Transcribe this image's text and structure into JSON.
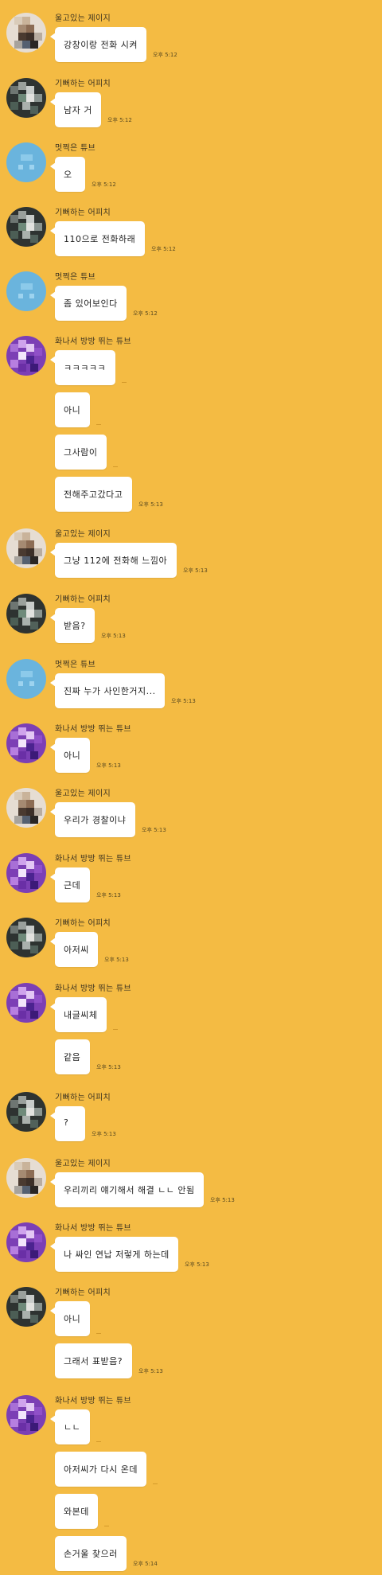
{
  "chat": {
    "groups": [
      {
        "sender": "울고있는 제이지",
        "avatar": "avatar-jayg-icon",
        "messages": [
          {
            "text": "강창이랑 전화 시켜",
            "time": "오후 5:12"
          }
        ]
      },
      {
        "sender": "기뻐하는 어피치",
        "avatar": "avatar-apeach-icon",
        "messages": [
          {
            "text": "남자 거",
            "time": "오후 5:12"
          }
        ]
      },
      {
        "sender": "멋쩍은 튜브",
        "avatar": "avatar-tube-blue-icon",
        "messages": [
          {
            "text": "오",
            "time": "오후 5:12"
          }
        ]
      },
      {
        "sender": "기뻐하는 어피치",
        "avatar": "avatar-apeach-icon",
        "messages": [
          {
            "text": "110으로 전화하래",
            "time": "오후 5:12"
          }
        ]
      },
      {
        "sender": "멋쩍은 튜브",
        "avatar": "avatar-tube-blue-icon",
        "messages": [
          {
            "text": "좀 있어보인다",
            "time": "오후 5:12"
          }
        ]
      },
      {
        "sender": "화나서 방방 뛰는 튜브",
        "avatar": "avatar-tube-purple-icon",
        "messages": [
          {
            "text": "ㅋㅋㅋㅋㅋ",
            "time": ""
          },
          {
            "text": "아니",
            "time": ""
          },
          {
            "text": "그사람이",
            "time": ""
          },
          {
            "text": "전해주고갔다고",
            "time": "오후 5:13"
          }
        ]
      },
      {
        "sender": "울고있는 제이지",
        "avatar": "avatar-jayg-icon",
        "messages": [
          {
            "text": "그냥 112에 전화해 느낌아",
            "time": "오후 5:13"
          }
        ]
      },
      {
        "sender": "기뻐하는 어피치",
        "avatar": "avatar-apeach-icon",
        "messages": [
          {
            "text": "받음?",
            "time": "오후 5:13"
          }
        ]
      },
      {
        "sender": "멋쩍은 튜브",
        "avatar": "avatar-tube-blue-icon",
        "messages": [
          {
            "text": "진짜 누가 사인한거지...",
            "time": "오후 5:13"
          }
        ]
      },
      {
        "sender": "화나서 방방 뛰는 튜브",
        "avatar": "avatar-tube-purple-icon",
        "messages": [
          {
            "text": "아니",
            "time": "오후 5:13"
          }
        ]
      },
      {
        "sender": "울고있는 제이지",
        "avatar": "avatar-jayg-icon",
        "messages": [
          {
            "text": "우리가 경찰이냐",
            "time": "오후 5:13"
          }
        ]
      },
      {
        "sender": "화나서 방방 뛰는 튜브",
        "avatar": "avatar-tube-purple-icon",
        "messages": [
          {
            "text": "근데",
            "time": "오후 5:13"
          }
        ]
      },
      {
        "sender": "기뻐하는 어피치",
        "avatar": "avatar-apeach-icon",
        "messages": [
          {
            "text": "아저씨",
            "time": "오후 5:13"
          }
        ]
      },
      {
        "sender": "화나서 방방 뛰는 튜브",
        "avatar": "avatar-tube-purple-icon",
        "messages": [
          {
            "text": "내글씨체",
            "time": ""
          },
          {
            "text": "같음",
            "time": "오후 5:13"
          }
        ]
      },
      {
        "sender": "기뻐하는 어피치",
        "avatar": "avatar-apeach-icon",
        "messages": [
          {
            "text": "?",
            "time": "오후 5:13"
          }
        ]
      },
      {
        "sender": "울고있는 제이지",
        "avatar": "avatar-jayg-icon",
        "messages": [
          {
            "text": "우리끼리 얘기해서 해결 ㄴㄴ 안됨",
            "time": "오후 5:13"
          }
        ]
      },
      {
        "sender": "화나서 방방 뛰는 튜브",
        "avatar": "avatar-tube-purple-icon",
        "messages": [
          {
            "text": "나 싸인 연납 저렇게 하는데",
            "time": "오후 5:13"
          }
        ]
      },
      {
        "sender": "기뻐하는 어피치",
        "avatar": "avatar-apeach-icon",
        "messages": [
          {
            "text": "아니",
            "time": ""
          },
          {
            "text": "그래서 표받음?",
            "time": "오후 5:13"
          }
        ]
      },
      {
        "sender": "화나서 방방 뛰는 튜브",
        "avatar": "avatar-tube-purple-icon",
        "messages": [
          {
            "text": "ㄴㄴ",
            "time": ""
          },
          {
            "text": "아저씨가 다시 온데",
            "time": ""
          },
          {
            "text": "와본데",
            "time": ""
          },
          {
            "text": "손거울 찾으러",
            "time": "오후 5:14"
          }
        ]
      }
    ]
  }
}
